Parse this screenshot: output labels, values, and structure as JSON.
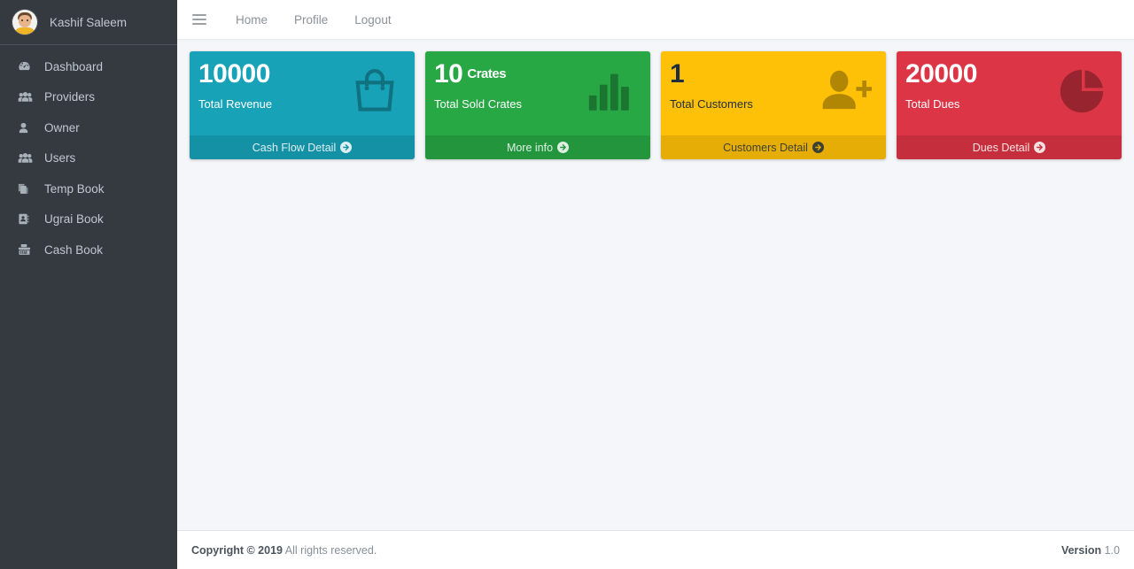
{
  "sidebar": {
    "brand": {
      "name": "Kashif Saleem",
      "avatar_icon": "user-avatar"
    },
    "items": [
      {
        "label": "Dashboard",
        "icon": "tachometer-icon"
      },
      {
        "label": "Providers",
        "icon": "users-icon"
      },
      {
        "label": "Owner",
        "icon": "user-icon"
      },
      {
        "label": "Users",
        "icon": "users-icon"
      },
      {
        "label": "Temp Book",
        "icon": "copy-layers-icon"
      },
      {
        "label": "Ugrai Book",
        "icon": "address-book-icon"
      },
      {
        "label": "Cash Book",
        "icon": "cash-register-icon"
      }
    ]
  },
  "navbar": {
    "menu_toggle_icon": "hamburger-icon",
    "links": [
      {
        "label": "Home"
      },
      {
        "label": "Profile"
      },
      {
        "label": "Logout"
      }
    ]
  },
  "cards": [
    {
      "value": "10000",
      "unit": "",
      "text": "Total Revenue",
      "link": "Cash Flow Detail",
      "icon": "shopping-bag-icon",
      "color": "#17a2b8"
    },
    {
      "value": "10",
      "unit": "Crates",
      "text": "Total Sold Crates",
      "link": "More info",
      "icon": "bar-chart-icon",
      "color": "#28a745"
    },
    {
      "value": "1",
      "unit": "",
      "text": "Total Customers",
      "link": "Customers Detail",
      "icon": "user-plus-icon",
      "color": "#ffc107"
    },
    {
      "value": "20000",
      "unit": "",
      "text": "Total Dues",
      "link": "Dues Detail",
      "icon": "pie-chart-icon",
      "color": "#dc3545"
    }
  ],
  "footer": {
    "copyright_strong": "Copyright © 2019",
    "copyright_rest": "All rights reserved.",
    "version_label": "Version",
    "version_value": "1.0"
  }
}
